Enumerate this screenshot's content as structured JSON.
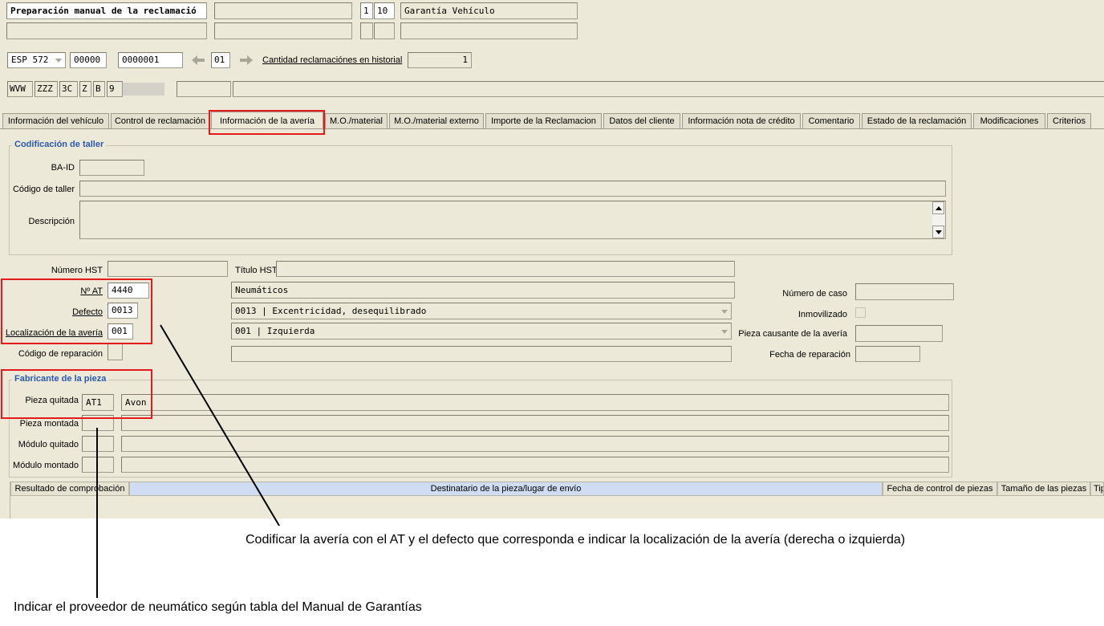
{
  "header": {
    "title": "Preparación manual de la reclamació",
    "num1": "1",
    "num2": "10",
    "warranty_type": "Garantía Vehículo"
  },
  "row2": {
    "country": "ESP 572",
    "code1": "00000",
    "code2": "0000001",
    "index": "01",
    "history_label": "Cantidad reclamaciónes en historial",
    "history_count": "1"
  },
  "row3": {
    "codes": [
      "WVW",
      "ZZZ",
      "3C",
      "Z",
      "B",
      "9"
    ]
  },
  "tabs": [
    "Información del vehículo",
    "Control de reclamación",
    "Información de la avería",
    "M.O./material",
    "M.O./material externo",
    "Importe de la Reclamacion",
    "Datos del cliente",
    "Información nota de crédito",
    "Comentario",
    "Estado de la reclamación",
    "Modificaciones",
    "Criterios"
  ],
  "taller": {
    "title": "Codificación de taller",
    "ba_id_label": "BA-ID",
    "codigo_label": "Código de taller",
    "descripcion_label": "Descripción"
  },
  "hst": {
    "numero_label": "Número HST",
    "titulo_label": "Título HST"
  },
  "averia": {
    "nat_label": "Nº AT",
    "nat_value": "4440",
    "nat_desc": "Neumáticos",
    "defecto_label": "Defecto",
    "defecto_value": "0013",
    "defecto_desc": "0013 | Excentricidad, desequilibrado",
    "localizacion_label": "Localización de la avería",
    "localizacion_value": "001",
    "localizacion_desc": "001 | Izquierda",
    "reparacion_label": "Código de reparación"
  },
  "right_fields": {
    "numero_caso_label": "Número de caso",
    "inmovilizado_label": "Inmovilizado",
    "pieza_causante_label": "Pieza causante de la avería",
    "fecha_reparacion_label": "Fecha de reparación"
  },
  "fabricante": {
    "title": "Fabricante de la pieza",
    "quitada_label": "Pieza quitada",
    "quitada_code": "AT1",
    "quitada_name": "Avon",
    "montada_label": "Pieza montada",
    "modulo_quitado_label": "Módulo quitado",
    "modulo_montado_label": "Módulo montado"
  },
  "table": {
    "headers": [
      "Resultado de comprobación",
      "Destinatario de la pieza/lugar de envío",
      "Fecha de control de piezas",
      "Tamaño de las piezas",
      "Tip"
    ]
  },
  "annotations": {
    "top": "Codificar la avería con el AT y el defecto que corresponda e indicar la localización de la avería (derecha o izquierda)",
    "bottom": "Indicar el proveedor de neumático según tabla del Manual de Garantías"
  },
  "colors": {
    "app_background": "#ece9d8",
    "highlight": "#e51b1b",
    "group_title": "#2a58ad",
    "table_header_selected": "#cfdcf2"
  }
}
